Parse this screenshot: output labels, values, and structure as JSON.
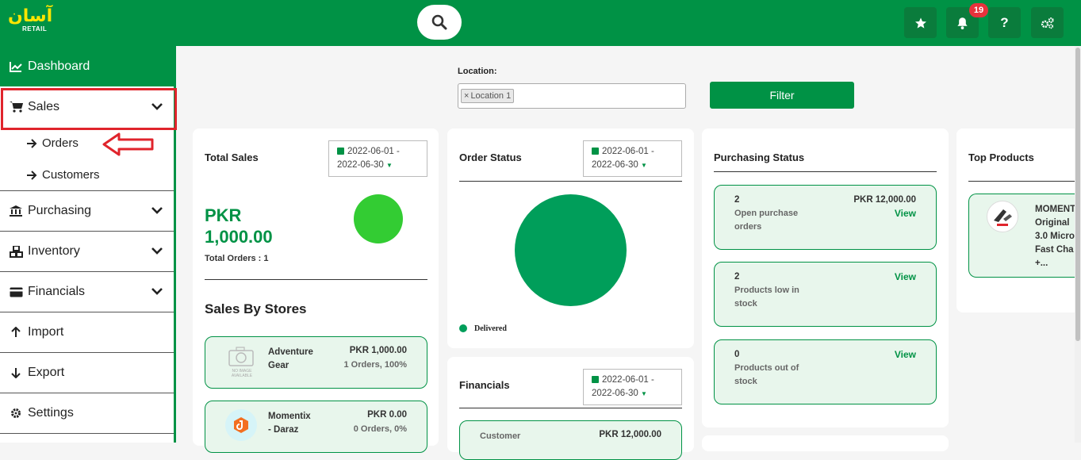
{
  "app": {
    "logo_text": "آسان",
    "logo_sub": "RETAIL",
    "notifications_count": "19"
  },
  "sidebar": {
    "items": [
      {
        "label": "Dashboard"
      },
      {
        "label": "Sales"
      },
      {
        "label": "Purchasing"
      },
      {
        "label": "Inventory"
      },
      {
        "label": "Financials"
      },
      {
        "label": "Import"
      },
      {
        "label": "Export"
      },
      {
        "label": "Settings"
      }
    ],
    "sales_sub": [
      {
        "label": "Orders"
      },
      {
        "label": "Customers"
      }
    ]
  },
  "filter": {
    "location_label": "Location:",
    "location_tag": "Location 1",
    "filter_label": "Filter"
  },
  "total_sales": {
    "title": "Total Sales",
    "date_line1": "2022-06-01 -",
    "date_line2": "2022-06-30",
    "amount_line1": "PKR",
    "amount_line2": "1,000.00",
    "orders": "Total Orders : 1",
    "chart_color": "#33cc33"
  },
  "sales_by_stores": {
    "title": "Sales By Stores",
    "stores": [
      {
        "name_line1": "Adventure",
        "name_line2": "Gear",
        "amount": "PKR 1,000.00",
        "detail": "1 Orders, 100%",
        "img_text": "NO IMAGE AVAILABLE"
      },
      {
        "name_line1": "Momentix",
        "name_line2": "- Daraz",
        "amount": "PKR 0.00",
        "detail": "0 Orders, 0%"
      }
    ]
  },
  "order_status": {
    "title": "Order Status",
    "date_line1": "2022-06-01 -",
    "date_line2": "2022-06-30",
    "legend": "Delivered",
    "chart_color": "#009e5a"
  },
  "financials": {
    "title": "Financials",
    "date_line1": "2022-06-01 -",
    "date_line2": "2022-06-30",
    "row_label": "Customer",
    "row_value": "PKR 12,000.00"
  },
  "purchasing_status": {
    "title": "Purchasing Status",
    "tiles": [
      {
        "count": "2",
        "label_line1": "Open purchase",
        "label_line2": "orders",
        "amount": "PKR 12,000.00",
        "link": "View"
      },
      {
        "count": "2",
        "label_line1": "Products low in",
        "label_line2": "stock",
        "amount": "",
        "link": "View"
      },
      {
        "count": "0",
        "label_line1": "Products out of",
        "label_line2": "stock",
        "amount": "",
        "link": "View"
      }
    ]
  },
  "top_products": {
    "title": "Top Products",
    "product_lines": [
      "MOMENT",
      "Original",
      "3.0 Micro",
      "Fast Cha",
      "+..."
    ]
  },
  "colors": {
    "brand_green": "#009245",
    "highlight_red": "#e0242c"
  }
}
